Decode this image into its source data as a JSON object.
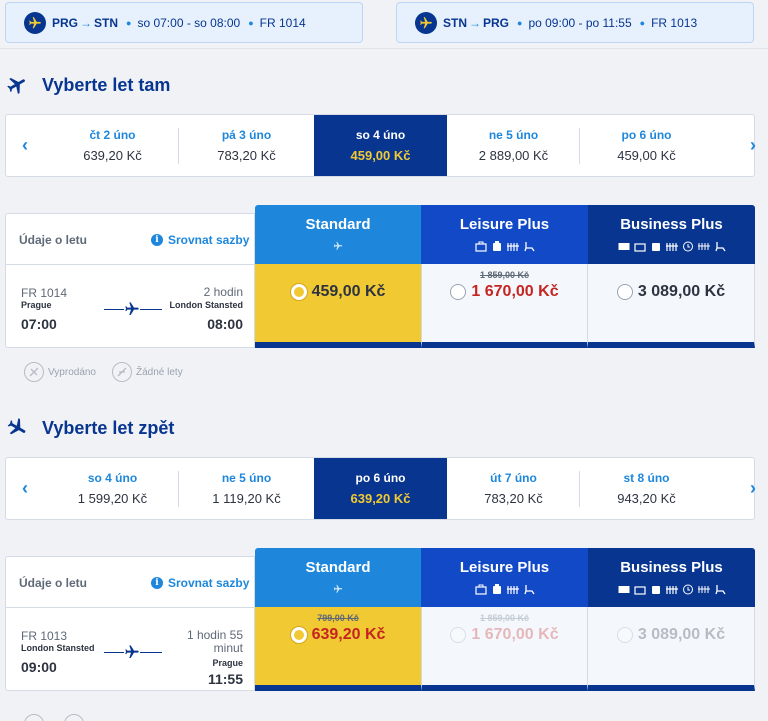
{
  "summary": {
    "outbound": {
      "route_from": "PRG",
      "route_to": "STN",
      "time": "so 07:00 - so 08:00",
      "flight_no": "FR 1014"
    },
    "inbound": {
      "route_from": "STN",
      "route_to": "PRG",
      "time": "po 09:00 - po 11:55",
      "flight_no": "FR 1013"
    }
  },
  "outbound": {
    "title": "Vyberte let tam",
    "dates": [
      {
        "label": "čt 2 úno",
        "price": "639,20 Kč"
      },
      {
        "label": "pá 3 úno",
        "price": "783,20 Kč"
      },
      {
        "label": "so 4 úno",
        "price": "459,00 Kč",
        "selected": true
      },
      {
        "label": "ne 5 úno",
        "price": "2 889,00 Kč"
      },
      {
        "label": "po 6 úno",
        "price": "459,00 Kč"
      }
    ],
    "details_label": "Údaje o letu",
    "compare_label": "Srovnat sazby",
    "fares": [
      {
        "name": "Standard",
        "old_price": "",
        "price": "459,00 Kč"
      },
      {
        "name": "Leisure Plus",
        "old_price": "1 859,00 Kč",
        "price": "1 670,00 Kč"
      },
      {
        "name": "Business Plus",
        "old_price": "",
        "price": "3 089,00 Kč"
      }
    ],
    "flight": {
      "number": "FR 1014",
      "depart_city": "Prague",
      "depart_time": "07:00",
      "duration": "2 hodin",
      "arrive_city": "London Stansted",
      "arrive_time": "08:00"
    },
    "legend": {
      "sold_out": "Vyprodáno",
      "no_flights": "Žádné lety"
    }
  },
  "inbound": {
    "title": "Vyberte let zpět",
    "dates": [
      {
        "label": "so 4 úno",
        "price": "1 599,20 Kč"
      },
      {
        "label": "ne 5 úno",
        "price": "1 119,20 Kč"
      },
      {
        "label": "po 6 úno",
        "price": "639,20 Kč",
        "selected": true
      },
      {
        "label": "út 7 úno",
        "price": "783,20 Kč"
      },
      {
        "label": "st 8 úno",
        "price": "943,20 Kč"
      }
    ],
    "details_label": "Údaje o letu",
    "compare_label": "Srovnat sazby",
    "fares": [
      {
        "name": "Standard",
        "old_price": "799,00 Kč",
        "price": "639,20 Kč"
      },
      {
        "name": "Leisure Plus",
        "old_price": "1 859,00 Kč",
        "price": "1 670,00 Kč"
      },
      {
        "name": "Business Plus",
        "old_price": "",
        "price": "3 089,00 Kč"
      }
    ],
    "flight": {
      "number": "FR 1013",
      "depart_city": "London Stansted",
      "depart_time": "09:00",
      "duration": "1 hodin 55 minut",
      "arrive_city": "Prague",
      "arrive_time": "11:55"
    }
  },
  "colors": {
    "brand_navy": "#073590",
    "accent_blue": "#1e87dc",
    "standard_yellow": "#f1c933",
    "price_red": "#c52521"
  }
}
